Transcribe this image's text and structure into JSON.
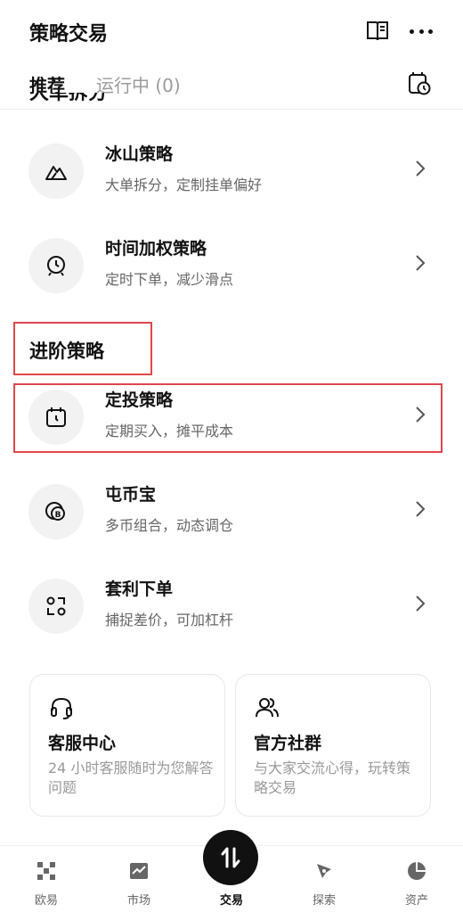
{
  "header": {
    "title": "策略交易",
    "book_icon": "book-icon",
    "more_icon": "more-icon"
  },
  "tabs": {
    "recommended": "推荐",
    "running": "运行中 (0)",
    "history_icon": "history-icon"
  },
  "cut_section_title": "大单拆分",
  "list_top": [
    {
      "name": "冰山策略",
      "desc": "大单拆分，定制挂单偏好",
      "icon": "iceberg-icon"
    },
    {
      "name": "时间加权策略",
      "desc": "定时下单，减少滑点",
      "icon": "clock-icon"
    }
  ],
  "advanced": {
    "title": "进阶策略",
    "items": [
      {
        "name": "定投策略",
        "desc": "定期买入，摊平成本",
        "icon": "calendar-icon"
      },
      {
        "name": "屯币宝",
        "desc": "多币组合，动态调仓",
        "icon": "coin-icon"
      },
      {
        "name": "套利下单",
        "desc": "捕捉差价，可加杠杆",
        "icon": "arbitrage-icon"
      }
    ]
  },
  "cards": [
    {
      "title": "客服中心",
      "desc": "24 小时客服随时为您解答问题",
      "icon": "headset-icon"
    },
    {
      "title": "官方社群",
      "desc": "与大家交流心得，玩转策略交易",
      "icon": "community-icon"
    }
  ],
  "nav": {
    "items": [
      {
        "label": "欧易",
        "icon": "okx-logo-icon"
      },
      {
        "label": "市场",
        "icon": "market-icon"
      },
      {
        "label": "交易",
        "icon": "trade-icon"
      },
      {
        "label": "探索",
        "icon": "explore-icon"
      },
      {
        "label": "资产",
        "icon": "assets-icon"
      }
    ]
  },
  "colors": {
    "highlight": "#e0474c",
    "text": "#111111",
    "muted": "#666666",
    "icon_bg": "#f2f2f2"
  }
}
